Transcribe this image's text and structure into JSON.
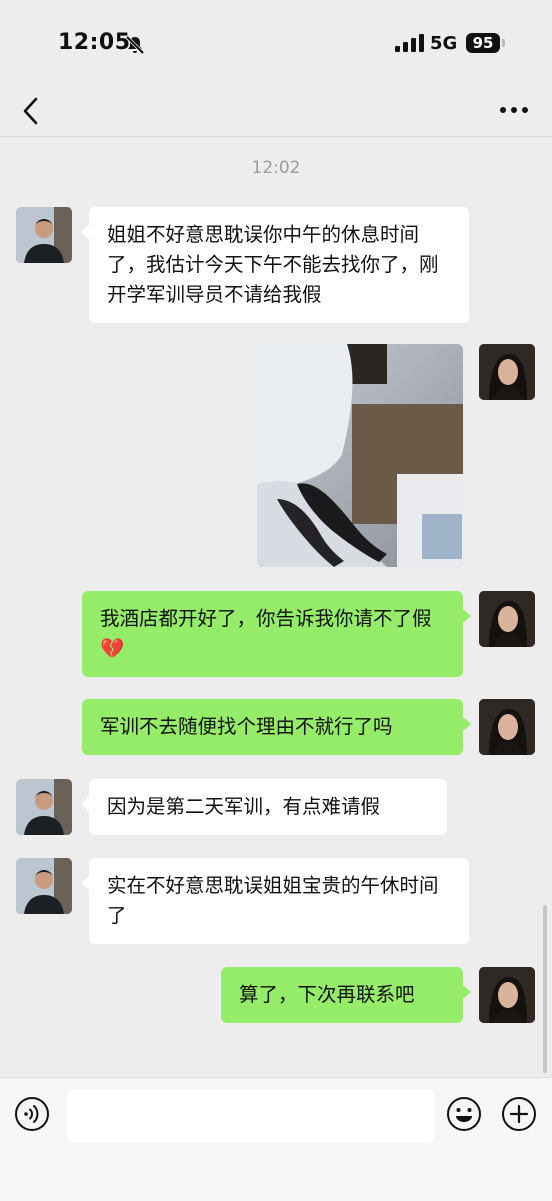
{
  "status_bar": {
    "time": "12:05",
    "network": "5G",
    "battery": "95"
  },
  "chat": {
    "timestamp": "12:02",
    "messages": [
      {
        "side": "in",
        "text": "姐姐不好意思耽误你中午的休息时间了，我估计今天下午不能去找你了，刚开学军训导员不请给我假"
      },
      {
        "side": "out",
        "type": "image"
      },
      {
        "side": "out",
        "text": "我酒店都开好了，你告诉我你请不了假💔"
      },
      {
        "side": "out",
        "text": "军训不去随便找个理由不就行了吗"
      },
      {
        "side": "in",
        "text": "因为是第二天军训，有点难请假"
      },
      {
        "side": "in",
        "text": "实在不好意思耽误姐姐宝贵的午休时间了"
      },
      {
        "side": "out",
        "text": "算了，下次再联系吧"
      }
    ]
  },
  "input": {
    "value": ""
  },
  "icons": {
    "bell": "bell-slash-icon",
    "back": "chevron-left-icon",
    "more": "more-icon",
    "voice": "voice-icon",
    "emoji": "emoji-icon",
    "plus": "plus-icon"
  },
  "colors": {
    "background": "#ededed",
    "outgoing_bubble": "#95ec69",
    "incoming_bubble": "#ffffff"
  }
}
